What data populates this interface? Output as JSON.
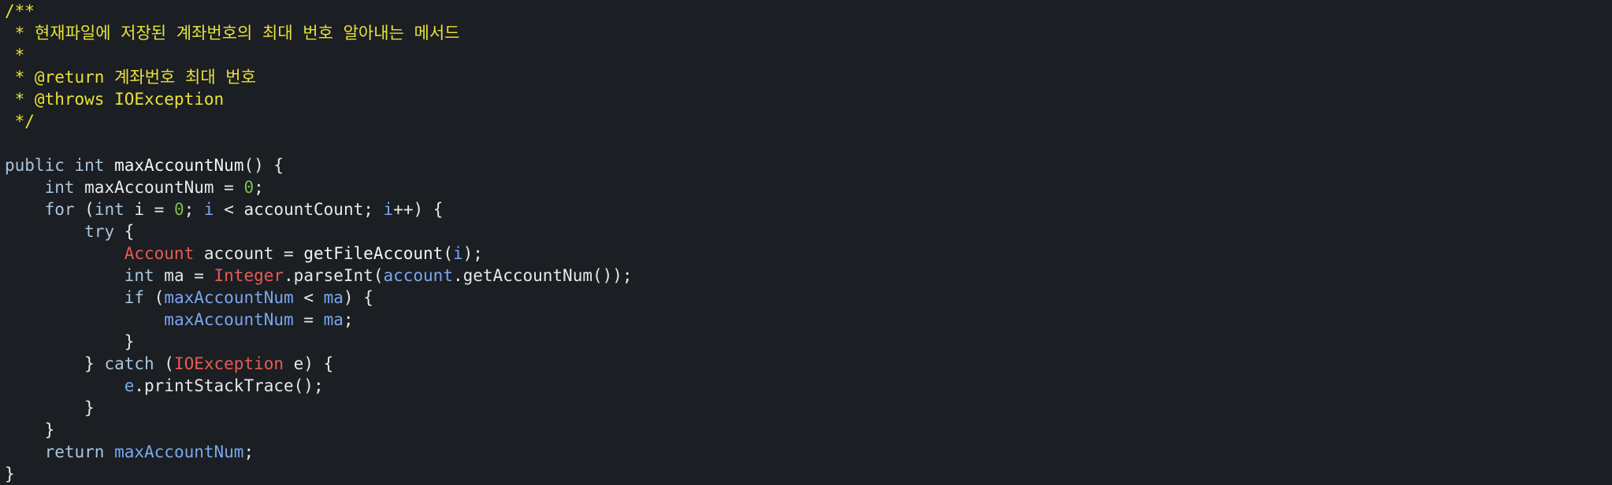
{
  "lines": [
    [
      {
        "t": "/**",
        "c": "comment"
      }
    ],
    [
      {
        "t": " * 현재파일에 저장된 계좌번호의 최대 번호 알아내는 메서드",
        "c": "comment"
      }
    ],
    [
      {
        "t": " *",
        "c": "comment"
      }
    ],
    [
      {
        "t": " * @return 계좌번호 최대 번호",
        "c": "comment"
      }
    ],
    [
      {
        "t": " * @throws IOException",
        "c": "comment"
      }
    ],
    [
      {
        "t": " */",
        "c": "comment"
      }
    ],
    [],
    [
      {
        "t": "public",
        "c": "kw"
      },
      {
        "t": " ",
        "c": "plain"
      },
      {
        "t": "int",
        "c": "kw"
      },
      {
        "t": " ",
        "c": "plain"
      },
      {
        "t": "maxAccountNum",
        "c": "fn"
      },
      {
        "t": "() {",
        "c": "plain"
      }
    ],
    [
      {
        "t": "    ",
        "c": "plain"
      },
      {
        "t": "int",
        "c": "kw"
      },
      {
        "t": " maxAccountNum = ",
        "c": "plain"
      },
      {
        "t": "0",
        "c": "num"
      },
      {
        "t": ";",
        "c": "plain"
      }
    ],
    [
      {
        "t": "    ",
        "c": "plain"
      },
      {
        "t": "for",
        "c": "kw"
      },
      {
        "t": " (",
        "c": "plain"
      },
      {
        "t": "int",
        "c": "kw"
      },
      {
        "t": " i = ",
        "c": "plain"
      },
      {
        "t": "0",
        "c": "num"
      },
      {
        "t": "; ",
        "c": "plain"
      },
      {
        "t": "i",
        "c": "var"
      },
      {
        "t": " < accountCount; ",
        "c": "plain"
      },
      {
        "t": "i",
        "c": "var"
      },
      {
        "t": "++) {",
        "c": "plain"
      }
    ],
    [
      {
        "t": "        ",
        "c": "plain"
      },
      {
        "t": "try",
        "c": "kw"
      },
      {
        "t": " {",
        "c": "plain"
      }
    ],
    [
      {
        "t": "            ",
        "c": "plain"
      },
      {
        "t": "Account",
        "c": "type"
      },
      {
        "t": " account = ",
        "c": "plain"
      },
      {
        "t": "getFileAccount",
        "c": "fn"
      },
      {
        "t": "(",
        "c": "plain"
      },
      {
        "t": "i",
        "c": "var"
      },
      {
        "t": ");",
        "c": "plain"
      }
    ],
    [
      {
        "t": "            ",
        "c": "plain"
      },
      {
        "t": "int",
        "c": "kw"
      },
      {
        "t": " ma = ",
        "c": "plain"
      },
      {
        "t": "Integer",
        "c": "type"
      },
      {
        "t": ".parseInt(",
        "c": "plain"
      },
      {
        "t": "account",
        "c": "var"
      },
      {
        "t": ".getAccountNum());",
        "c": "plain"
      }
    ],
    [
      {
        "t": "            ",
        "c": "plain"
      },
      {
        "t": "if",
        "c": "kw"
      },
      {
        "t": " (",
        "c": "plain"
      },
      {
        "t": "maxAccountNum",
        "c": "var"
      },
      {
        "t": " < ",
        "c": "plain"
      },
      {
        "t": "ma",
        "c": "var"
      },
      {
        "t": ") {",
        "c": "plain"
      }
    ],
    [
      {
        "t": "                ",
        "c": "plain"
      },
      {
        "t": "maxAccountNum",
        "c": "var"
      },
      {
        "t": " = ",
        "c": "plain"
      },
      {
        "t": "ma",
        "c": "var"
      },
      {
        "t": ";",
        "c": "plain"
      }
    ],
    [
      {
        "t": "            }",
        "c": "plain"
      }
    ],
    [
      {
        "t": "        } ",
        "c": "plain"
      },
      {
        "t": "catch",
        "c": "kw"
      },
      {
        "t": " (",
        "c": "plain"
      },
      {
        "t": "IOException",
        "c": "type"
      },
      {
        "t": " e) {",
        "c": "plain"
      }
    ],
    [
      {
        "t": "            ",
        "c": "plain"
      },
      {
        "t": "e",
        "c": "var"
      },
      {
        "t": ".printStackTrace();",
        "c": "plain"
      }
    ],
    [
      {
        "t": "        }",
        "c": "plain"
      }
    ],
    [
      {
        "t": "    }",
        "c": "plain"
      }
    ],
    [
      {
        "t": "    ",
        "c": "plain"
      },
      {
        "t": "return",
        "c": "kw"
      },
      {
        "t": " ",
        "c": "plain"
      },
      {
        "t": "maxAccountNum",
        "c": "var"
      },
      {
        "t": ";",
        "c": "plain"
      }
    ],
    [
      {
        "t": "}",
        "c": "plain"
      }
    ]
  ]
}
